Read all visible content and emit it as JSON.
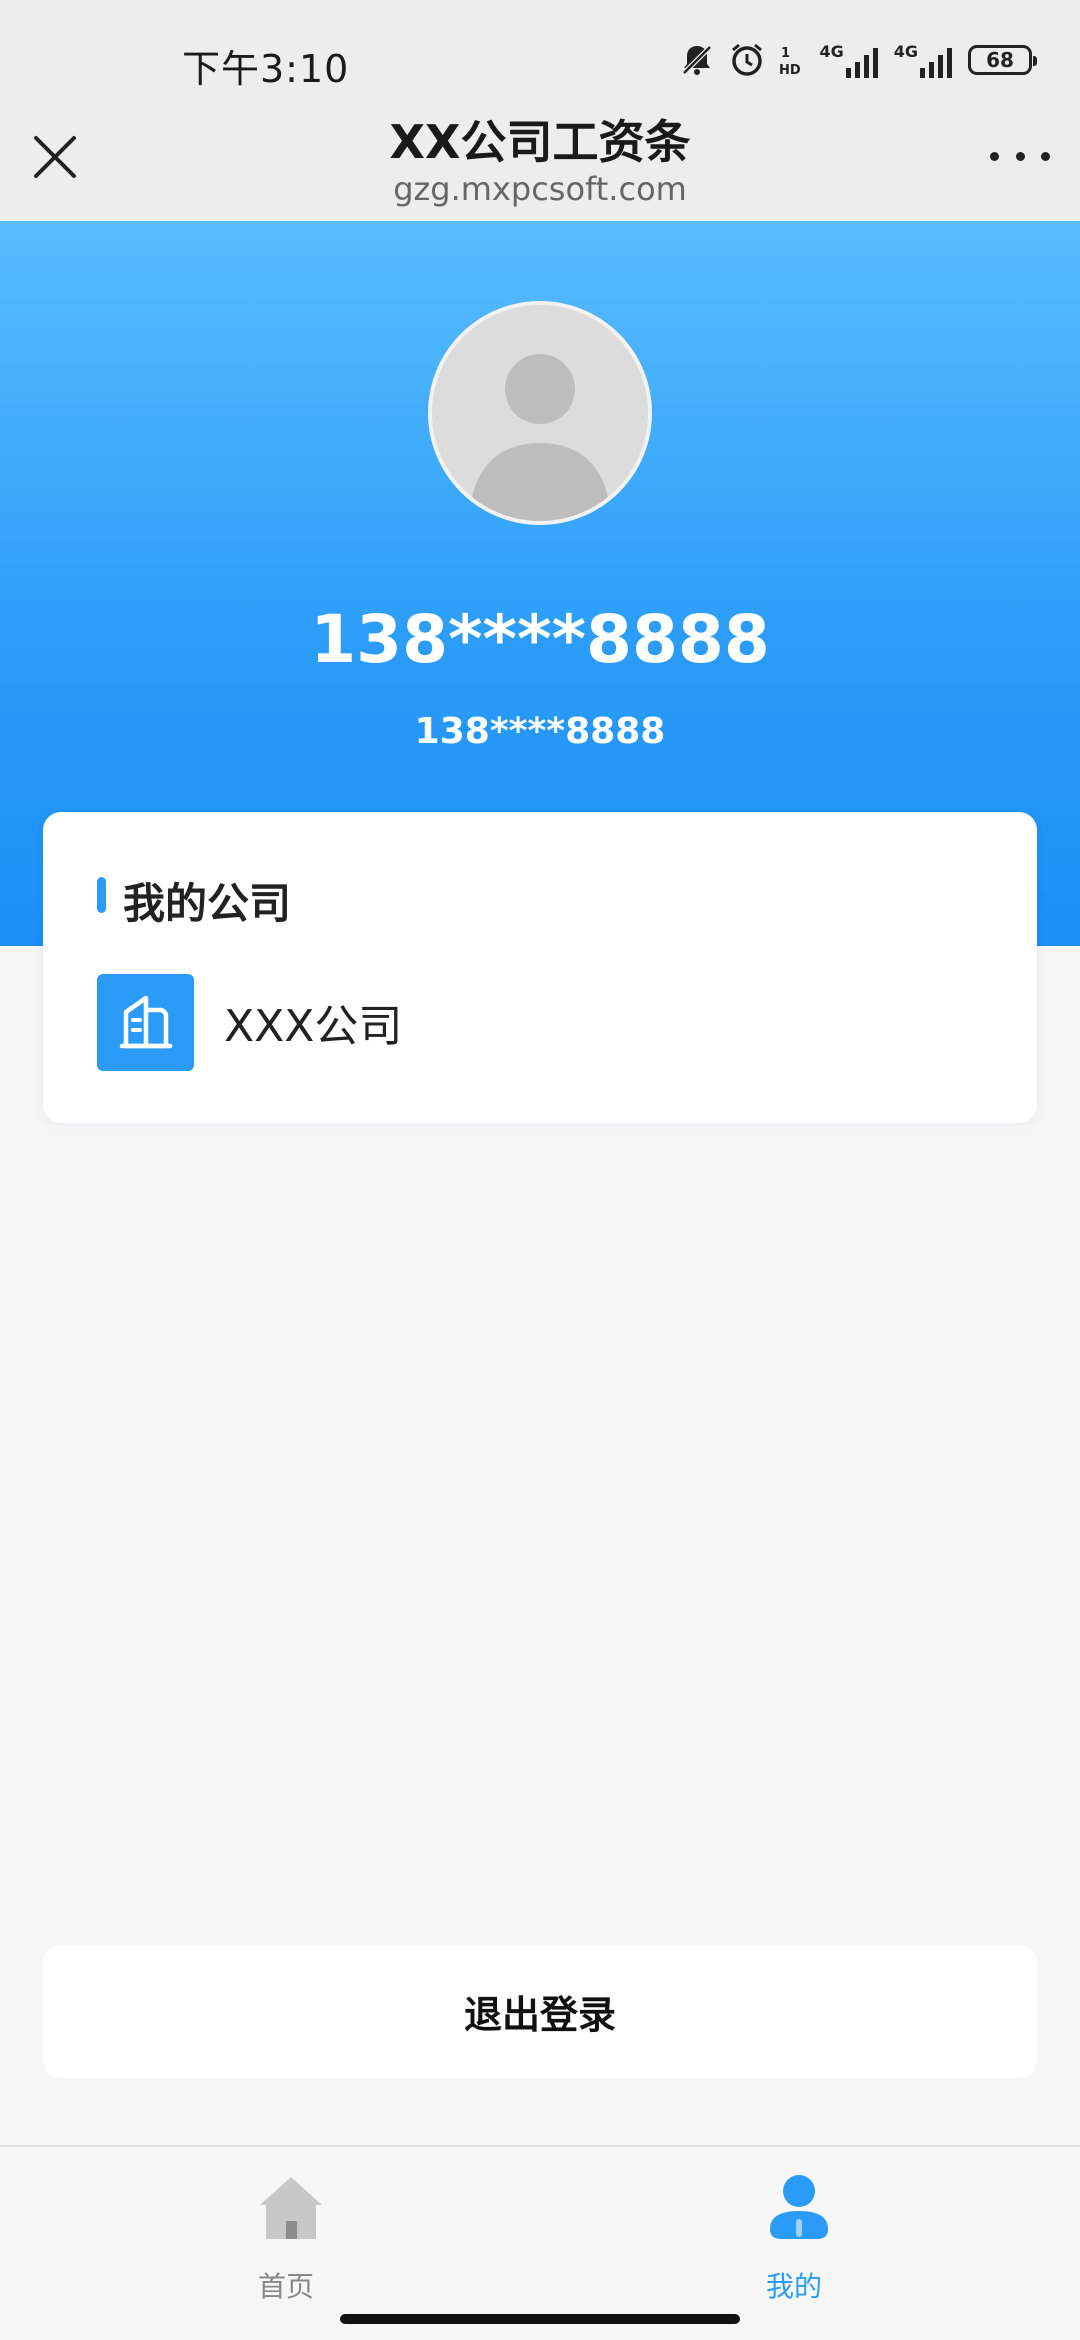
{
  "status_bar": {
    "time": "下午3:10",
    "network_1": "4G",
    "network_2": "4G",
    "battery": "68"
  },
  "title_bar": {
    "title": "XX公司工资条",
    "url": "gzg.mxpcsoft.com"
  },
  "profile": {
    "name": "138****8888",
    "phone": "138****8888"
  },
  "company_card": {
    "heading": "我的公司",
    "company_name": "XXX公司"
  },
  "logout_label": "退出登录",
  "tabs": [
    {
      "label": "首页"
    },
    {
      "label": "我的"
    }
  ],
  "colors": {
    "accent": "#2a9cf8",
    "header_top": "#58bcff",
    "header_bottom": "#1b8ff7"
  }
}
